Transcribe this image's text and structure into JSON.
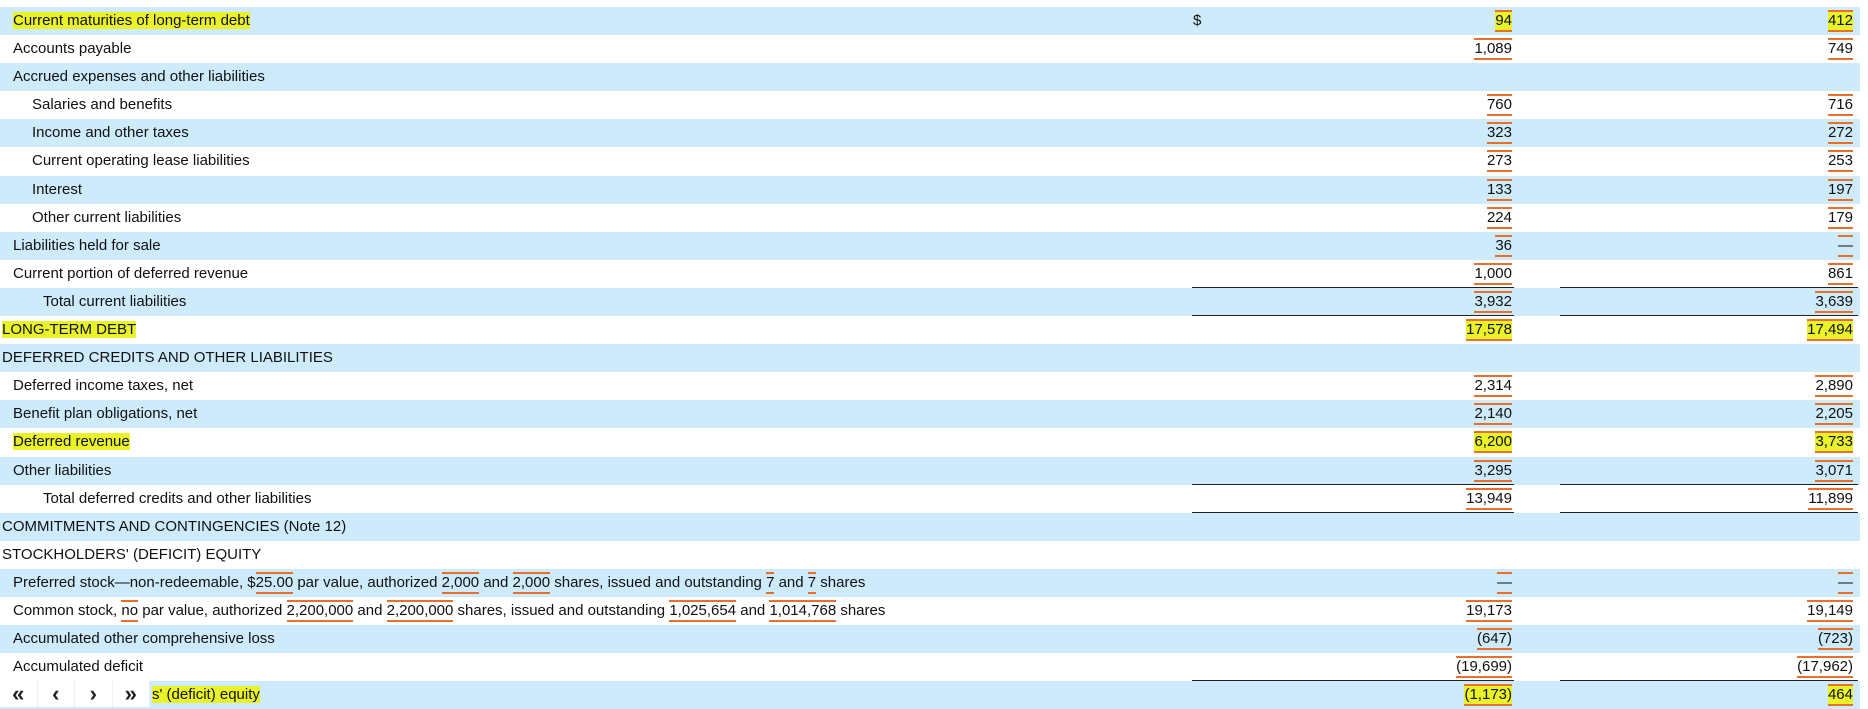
{
  "currency_symbol": "$",
  "rows": [
    {
      "label": [
        {
          "t": "Current maturities of long-term debt"
        }
      ],
      "indent": 1,
      "v1": "94",
      "v2": "412",
      "hl_label": true,
      "hl_vals": true,
      "dollar": true
    },
    {
      "label": [
        {
          "t": "Accounts payable"
        }
      ],
      "indent": 1,
      "v1": "1,089",
      "v2": "749"
    },
    {
      "label": [
        {
          "t": "Accrued expenses and other liabilities"
        }
      ],
      "indent": 1
    },
    {
      "label": [
        {
          "t": "Salaries and benefits"
        }
      ],
      "indent": 2,
      "v1": "760",
      "v2": "716"
    },
    {
      "label": [
        {
          "t": "Income and other taxes"
        }
      ],
      "indent": 2,
      "v1": "323",
      "v2": "272"
    },
    {
      "label": [
        {
          "t": "Current operating lease liabilities"
        }
      ],
      "indent": 2,
      "v1": "273",
      "v2": "253"
    },
    {
      "label": [
        {
          "t": "Interest"
        }
      ],
      "indent": 2,
      "v1": "133",
      "v2": "197"
    },
    {
      "label": [
        {
          "t": "Other current liabilities"
        }
      ],
      "indent": 2,
      "v1": "224",
      "v2": "179"
    },
    {
      "label": [
        {
          "t": "Liabilities held for sale"
        }
      ],
      "indent": 1,
      "v1": "36",
      "v2": "—"
    },
    {
      "label": [
        {
          "t": "Current portion of deferred revenue"
        }
      ],
      "indent": 1,
      "v1": "1,000",
      "v2": "861",
      "line_below": true
    },
    {
      "label": [
        {
          "t": "Total current liabilities"
        }
      ],
      "indent": 3,
      "v1": "3,932",
      "v2": "3,639",
      "line_below": true
    },
    {
      "label": [
        {
          "t": "LONG-TERM DEBT"
        }
      ],
      "indent": 0,
      "v1": "17,578",
      "v2": "17,494",
      "hl_label": true,
      "hl_vals": true
    },
    {
      "label": [
        {
          "t": "DEFERRED CREDITS AND OTHER LIABILITIES"
        }
      ],
      "indent": 0
    },
    {
      "label": [
        {
          "t": "Deferred income taxes, net"
        }
      ],
      "indent": 1,
      "v1": "2,314",
      "v2": "2,890"
    },
    {
      "label": [
        {
          "t": "Benefit plan obligations, net"
        }
      ],
      "indent": 1,
      "v1": "2,140",
      "v2": "2,205"
    },
    {
      "label": [
        {
          "t": "Deferred revenue"
        }
      ],
      "indent": 1,
      "v1": "6,200",
      "v2": "3,733",
      "hl_label": true,
      "hl_vals": true
    },
    {
      "label": [
        {
          "t": "Other liabilities"
        }
      ],
      "indent": 1,
      "v1": "3,295",
      "v2": "3,071",
      "line_below": true
    },
    {
      "label": [
        {
          "t": "Total deferred credits and other liabilities"
        }
      ],
      "indent": 3,
      "v1": "13,949",
      "v2": "11,899",
      "line_below": true
    },
    {
      "label": [
        {
          "t": "COMMITMENTS AND CONTINGENCIES (Note 12)"
        }
      ],
      "indent": 0
    },
    {
      "label": [
        {
          "t": "STOCKHOLDERS' (DEFICIT) EQUITY"
        }
      ],
      "indent": 0
    },
    {
      "label": [
        {
          "t": "Preferred stock—non-redeemable, $"
        },
        {
          "t": "25.00",
          "tag": true
        },
        {
          "t": " par value, authorized "
        },
        {
          "t": "2,000",
          "tag": true
        },
        {
          "t": " and "
        },
        {
          "t": "2,000",
          "tag": true
        },
        {
          "t": " shares, issued and outstanding "
        },
        {
          "t": "7",
          "tag": true
        },
        {
          "t": " and "
        },
        {
          "t": "7",
          "tag": true
        },
        {
          "t": " shares"
        }
      ],
      "indent": 1,
      "v1": "—",
      "v2": "—"
    },
    {
      "label": [
        {
          "t": "Common stock, "
        },
        {
          "t": "no",
          "tag": true
        },
        {
          "t": " par value, authorized "
        },
        {
          "t": "2,200,000",
          "tag": true
        },
        {
          "t": " and "
        },
        {
          "t": "2,200,000",
          "tag": true
        },
        {
          "t": " shares, issued and outstanding "
        },
        {
          "t": "1,025,654",
          "tag": true
        },
        {
          "t": " and "
        },
        {
          "t": "1,014,768",
          "tag": true
        },
        {
          "t": " shares"
        }
      ],
      "indent": 1,
      "v1": "19,173",
      "v2": "19,149"
    },
    {
      "label": [
        {
          "t": "Accumulated other comprehensive loss"
        }
      ],
      "indent": 1,
      "v1": "(647)",
      "v2": "(723)"
    },
    {
      "label": [
        {
          "t": "Accumulated deficit"
        }
      ],
      "indent": 1,
      "v1": "(19,699)",
      "v2": "(17,962)",
      "line_below": true
    },
    {
      "label": [
        {
          "t": "s' (deficit) equity"
        }
      ],
      "indent": 3,
      "v1": "(1,173)",
      "v2": "464",
      "hl_label": true,
      "hl_vals": true,
      "label_offset": true
    }
  ],
  "pager": {
    "first": "«",
    "prev": "‹",
    "next": "›",
    "last": "»"
  },
  "colors": {
    "stripe": "#cdebfb",
    "tag": "#e8702a",
    "highlight": "#eaf22a"
  }
}
